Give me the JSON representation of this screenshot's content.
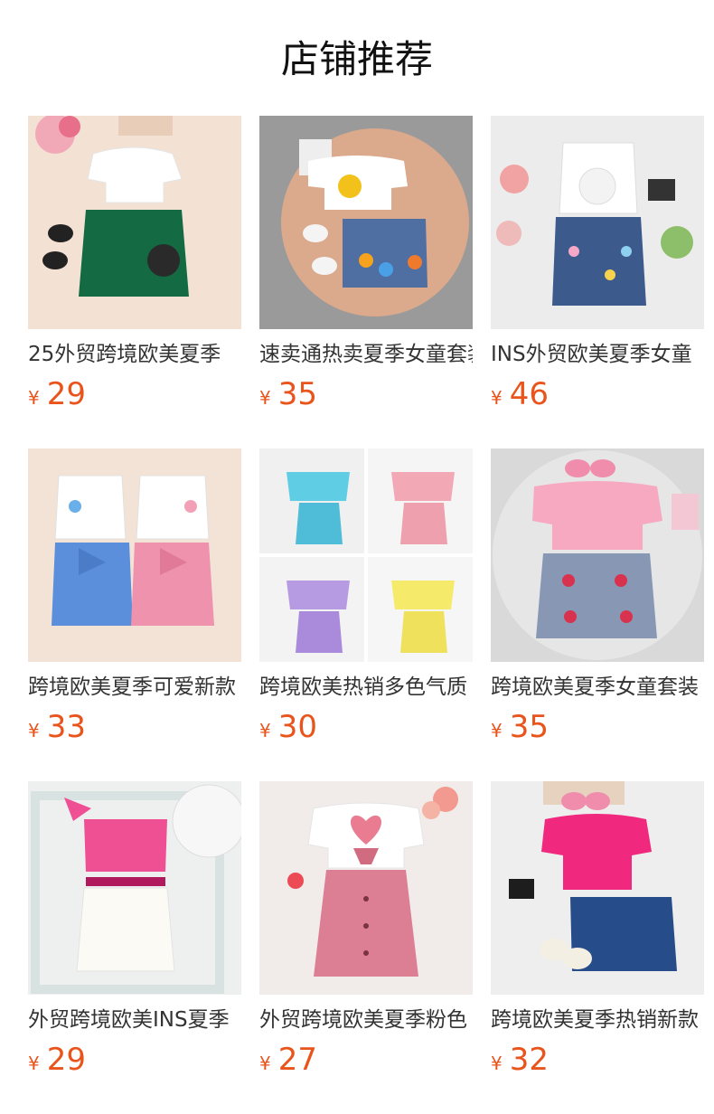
{
  "page": {
    "title": "店铺推荐"
  },
  "products": [
    {
      "name": "25外贸跨境欧美夏季",
      "currency": "¥",
      "price": "29"
    },
    {
      "name": "速卖通热卖夏季女童套装",
      "currency": "¥",
      "price": "35"
    },
    {
      "name": "INS外贸欧美夏季女童",
      "currency": "¥",
      "price": "46"
    },
    {
      "name": "跨境欧美夏季可爱新款",
      "currency": "¥",
      "price": "33"
    },
    {
      "name": "跨境欧美热销多色气质",
      "currency": "¥",
      "price": "30"
    },
    {
      "name": "跨境欧美夏季女童套装",
      "currency": "¥",
      "price": "35"
    },
    {
      "name": "外贸跨境欧美INS夏季",
      "currency": "¥",
      "price": "29"
    },
    {
      "name": "外贸跨境欧美夏季粉色",
      "currency": "¥",
      "price": "27"
    },
    {
      "name": "跨境欧美夏季热销新款",
      "currency": "¥",
      "price": "32"
    }
  ]
}
